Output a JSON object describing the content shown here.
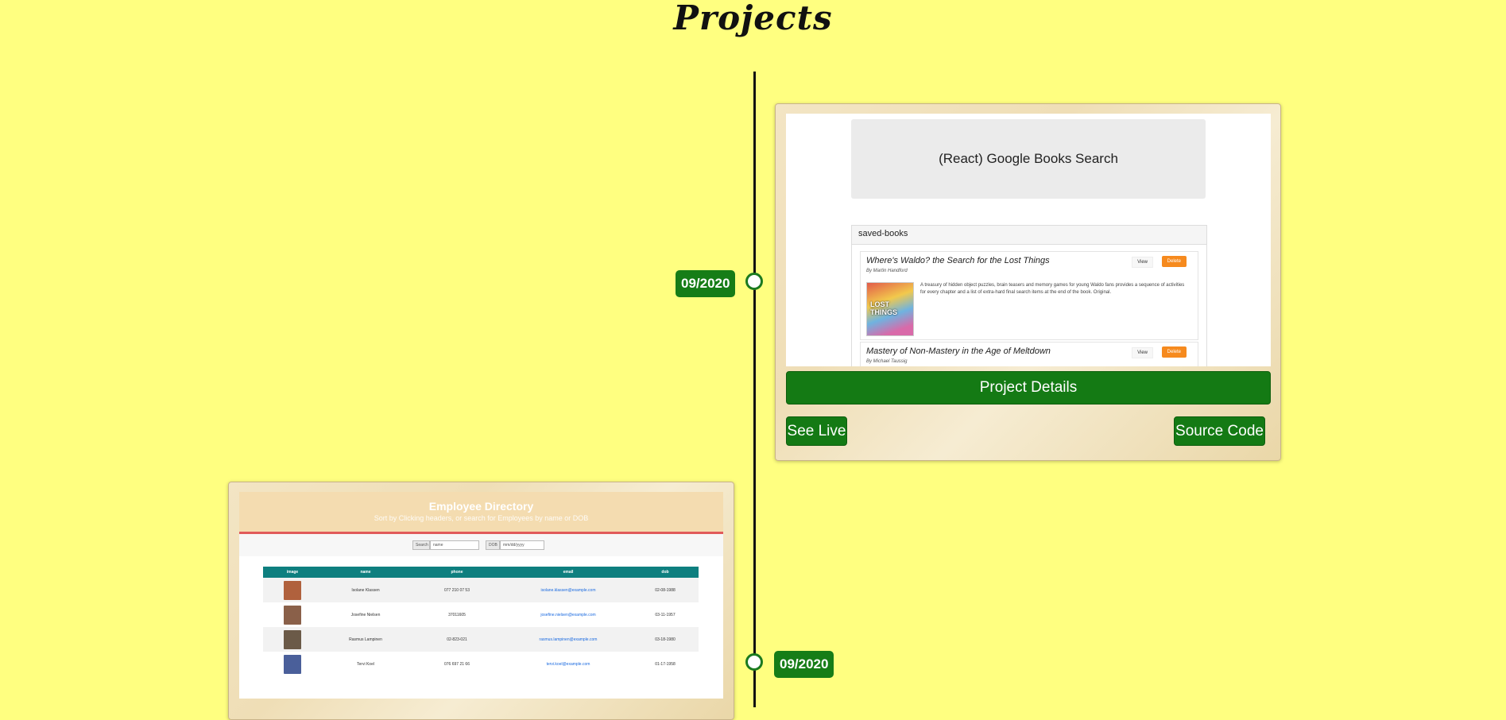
{
  "page": {
    "title": "Projects",
    "background": "#ffff80"
  },
  "accent_color": "#147a14",
  "timeline": {
    "entries": [
      {
        "date": "09/2020",
        "screenshot": {
          "hero_title": "(React) Google Books Search",
          "panel_heading": "saved-books",
          "books": [
            {
              "title": "Where's Waldo? the Search for the Lost Things",
              "author": "By Martin Handford",
              "view_label": "View",
              "delete_label": "Delete",
              "description": "A treasury of hidden object puzzles, brain teasers and memory games for young Waldo fans provides a sequence of activities for every chapter and a list of extra-hard final search items at the end of the book. Original.",
              "cover_text": "LOST THINGS"
            },
            {
              "title": "Mastery of Non-Mastery in the Age of Meltdown",
              "author": "By Michael Taussig",
              "view_label": "View",
              "delete_label": "Delete"
            }
          ]
        },
        "details_label": "Project Details",
        "live_label": "See Live",
        "source_label": "Source Code"
      },
      {
        "date": "09/2020",
        "screenshot": {
          "title": "Employee Directory",
          "subtitle": "Sort by Clicking headers, or search for Employees by name or DOB",
          "search_label": "Search",
          "search_placeholder": "name",
          "dob_label": "DOB",
          "dob_placeholder": "mm/dd/yyyy",
          "columns": [
            "image",
            "name",
            "phone",
            "email",
            "dob"
          ],
          "rows": [
            {
              "name": "Isolane Klassen",
              "phone": "077 210 07 53",
              "email": "isolane.klassen@example.com",
              "dob": "02-08-1988",
              "avatar_color": "#b0613d"
            },
            {
              "name": "Josefine Nielsen",
              "phone": "37011605",
              "email": "josefine.nielsen@example.com",
              "dob": "03-11-1957",
              "avatar_color": "#8a6049"
            },
            {
              "name": "Rasmus Lampinen",
              "phone": "02-823-021",
              "email": "rasmus.lampinen@example.com",
              "dob": "03-18-1980",
              "avatar_color": "#6b5a48"
            },
            {
              "name": "Tervi Koel",
              "phone": "076 697 21 66",
              "email": "tervi.koel@example.com",
              "dob": "01-17-1958",
              "avatar_color": "#4a5f9a"
            }
          ]
        }
      }
    ]
  }
}
